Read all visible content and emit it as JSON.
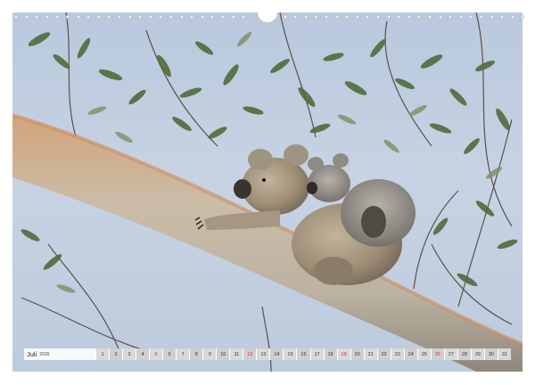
{
  "calendar": {
    "month": "Juli",
    "year": "2026",
    "days": [
      "1",
      "2",
      "3",
      "4",
      "5",
      "6",
      "7",
      "8",
      "9",
      "10",
      "11",
      "12",
      "13",
      "14",
      "15",
      "16",
      "17",
      "18",
      "19",
      "20",
      "21",
      "22",
      "23",
      "24",
      "25",
      "26",
      "27",
      "28",
      "29",
      "30",
      "31"
    ],
    "sundays": [
      "5",
      "12",
      "19",
      "26"
    ]
  },
  "colors": {
    "sky": "#c2d0e2",
    "branch": "#c9b59c",
    "koala_fur": "#a89a85",
    "leaf": "#4f6b3a",
    "sunday_red": "#d2233c"
  }
}
